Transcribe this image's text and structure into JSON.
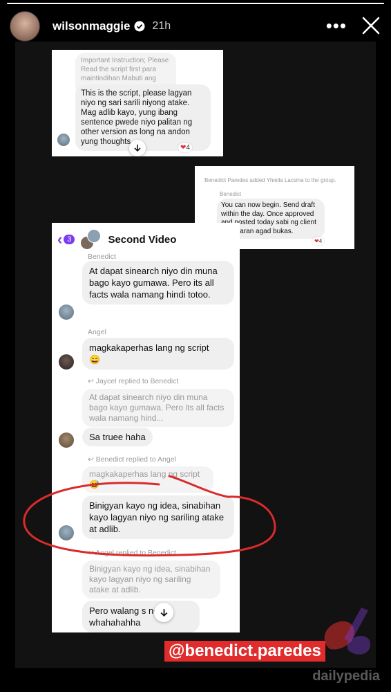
{
  "header": {
    "username": "wilsonmaggie",
    "time": "21h"
  },
  "card1": {
    "reply_quote": "Important Instruction; Please Read the script first para maintindihan Mabuti ang ga...",
    "message": "This is the script, please lagyan niyo ng sari sarili niyong atake. Mag adlib kayo, yung ibang sentence pwede niyo palitan ng other version as long na andon yung thoughts.",
    "reaction_count": "4"
  },
  "card2": {
    "system_note": "Benedict Paredes added Yhiella Lacsina to the group.",
    "sender": "Benedict",
    "message": "You can now begin. Send draft within the day. Once approved and posted today sabi ng client babayaran agad bukas.",
    "reaction_count": "4"
  },
  "card3": {
    "back_count": "3",
    "title": "Second Video",
    "messages": [
      {
        "sender": "Benedict",
        "text": "At dapat sinearch niyo din muna bago kayo gumawa. Pero its all facts wala namang hindi totoo."
      },
      {
        "sender": "Angel",
        "text": "magkakaperhas lang ng script",
        "emoji": "😄"
      },
      {
        "reply_note": "Jaycel replied to Benedict",
        "quoted": "At dapat sinearch niyo din muna bago kayo gumawa. Pero its all facts wala namang hind...",
        "text": "Sa truee haha"
      },
      {
        "reply_note": "Benedict replied to Angel",
        "quoted": "magkakaperhas lang ng script",
        "quoted_emoji": "😅",
        "text": "Binigyan kayo ng idea, sinabihan kayo lagyan niyo ng sariling atake at adlib."
      },
      {
        "reply_note": "Angel replied to Benedict",
        "quoted": "Binigyan kayo ng idea, sinabihan kayo lagyan niyo ng sariling atake at adlib.",
        "text": "Pero walang s    nod whahahahha"
      }
    ]
  },
  "mention": "@benedict.paredes",
  "watermark": "dailypedia",
  "colors": {
    "accent": "#7a3cf0",
    "heart": "#e0333a",
    "annotation": "#d92b2b",
    "mention_bg": "#e02c2c"
  },
  "icons": [
    "verified-badge-icon",
    "more-dots-icon",
    "close-icon",
    "chevron-left-icon",
    "arrow-down-icon",
    "heart-icon"
  ]
}
